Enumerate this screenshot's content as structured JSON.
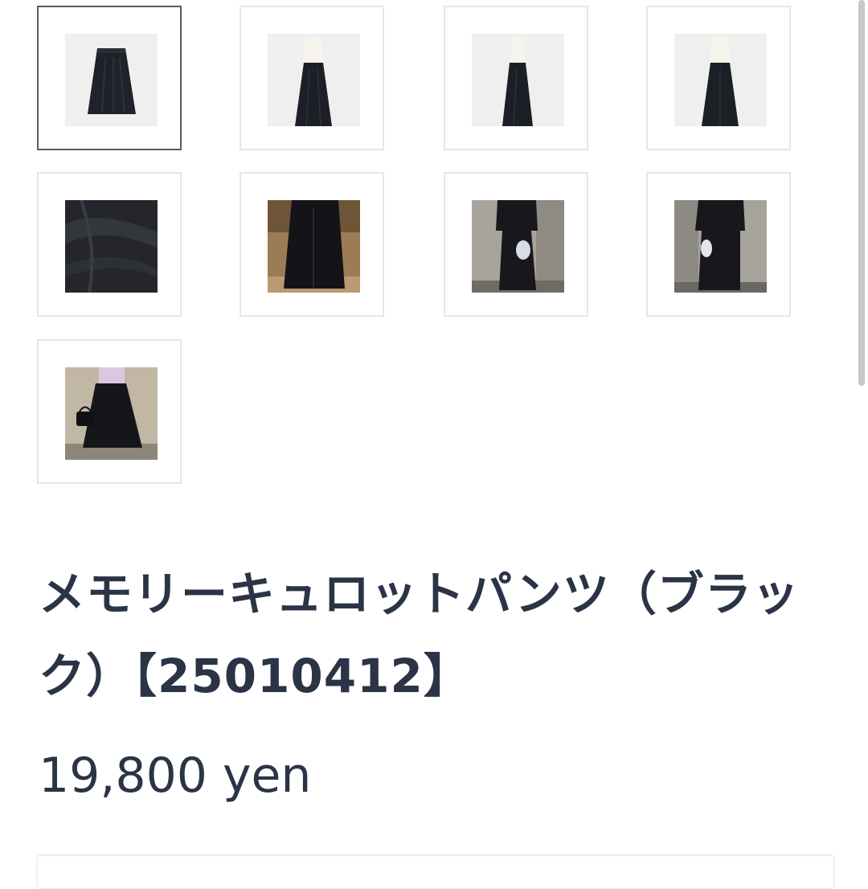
{
  "gallery": {
    "thumbnails": [
      {
        "icon": "skirt-flat-photo",
        "selected": true
      },
      {
        "icon": "mannequin-front-photo",
        "selected": false
      },
      {
        "icon": "mannequin-side-photo",
        "selected": false
      },
      {
        "icon": "mannequin-back-photo",
        "selected": false
      },
      {
        "icon": "fabric-closeup-photo",
        "selected": false
      },
      {
        "icon": "model-walking-photo",
        "selected": false
      },
      {
        "icon": "model-street-side-photo",
        "selected": false
      },
      {
        "icon": "model-street-back-photo",
        "selected": false
      },
      {
        "icon": "model-with-handbag-photo",
        "selected": false
      }
    ]
  },
  "product": {
    "title": "メモリーキュロットパンツ（ブラック）【25010412】",
    "price": "19,800 yen"
  },
  "colors": {
    "text": "#2a3446",
    "thumb_border": "#e3e6eb",
    "thumb_border_selected": "#5a5a5a"
  }
}
